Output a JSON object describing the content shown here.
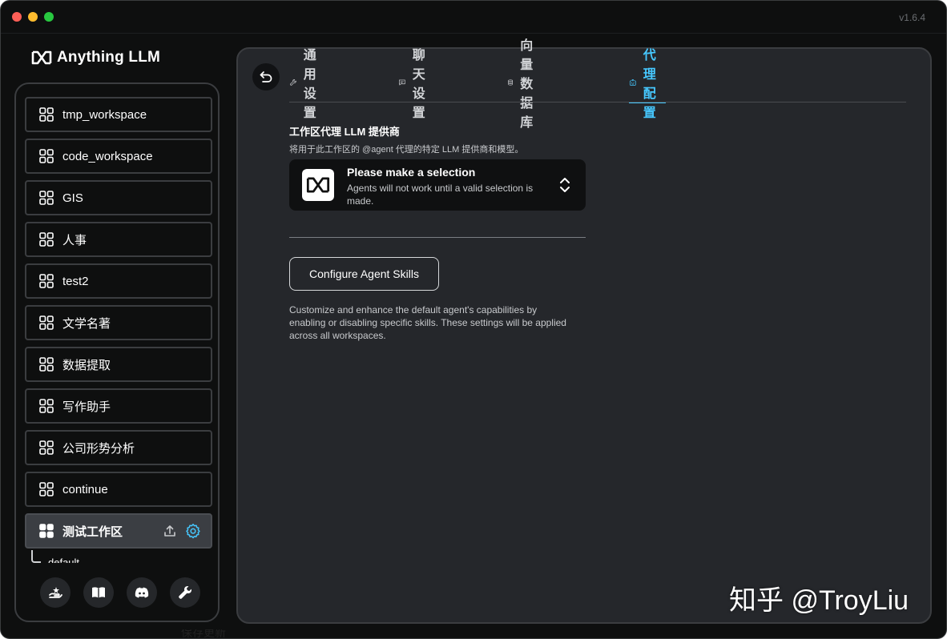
{
  "app": {
    "version": "v1.6.4",
    "logo_text": "Anything LLM"
  },
  "sidebar": {
    "workspaces": [
      {
        "label": "tmp_workspace"
      },
      {
        "label": "code_workspace"
      },
      {
        "label": "GIS"
      },
      {
        "label": "人事"
      },
      {
        "label": "test2"
      },
      {
        "label": "文学名著"
      },
      {
        "label": "数据提取"
      },
      {
        "label": "写作助手"
      },
      {
        "label": "公司形势分析"
      },
      {
        "label": "continue"
      },
      {
        "label": "测试工作区"
      }
    ],
    "active_index": 10,
    "thread_label": "default",
    "footer_icons": [
      "community-hub-icon",
      "docs-book-icon",
      "discord-icon",
      "settings-wrench-icon"
    ]
  },
  "tabs": [
    {
      "label": "通用设置",
      "icon": "wrench-icon"
    },
    {
      "label": "聊天设置",
      "icon": "chat-icon"
    },
    {
      "label": "向量数据库",
      "icon": "database-icon"
    },
    {
      "label": "代理配置",
      "icon": "robot-icon"
    }
  ],
  "active_tab": 3,
  "agent": {
    "section_title": "工作区代理 LLM 提供商",
    "section_desc": "将用于此工作区的 @agent 代理的特定 LLM 提供商和模型。",
    "provider_title": "Please make a selection",
    "provider_subtitle": "Agents will not work until a valid selection is made.",
    "skills_button": "Configure Agent Skills",
    "skills_desc": "Customize and enhance the default agent's capabilities by enabling or disabling specific skills. These settings will be applied across all workspaces."
  },
  "colors": {
    "accent": "#46c8ff",
    "panel_bg": "#25272b",
    "window_bg": "#0e0f0f"
  },
  "watermark": "知乎 @TroyLiu",
  "bottom_fragment": "保存更新"
}
